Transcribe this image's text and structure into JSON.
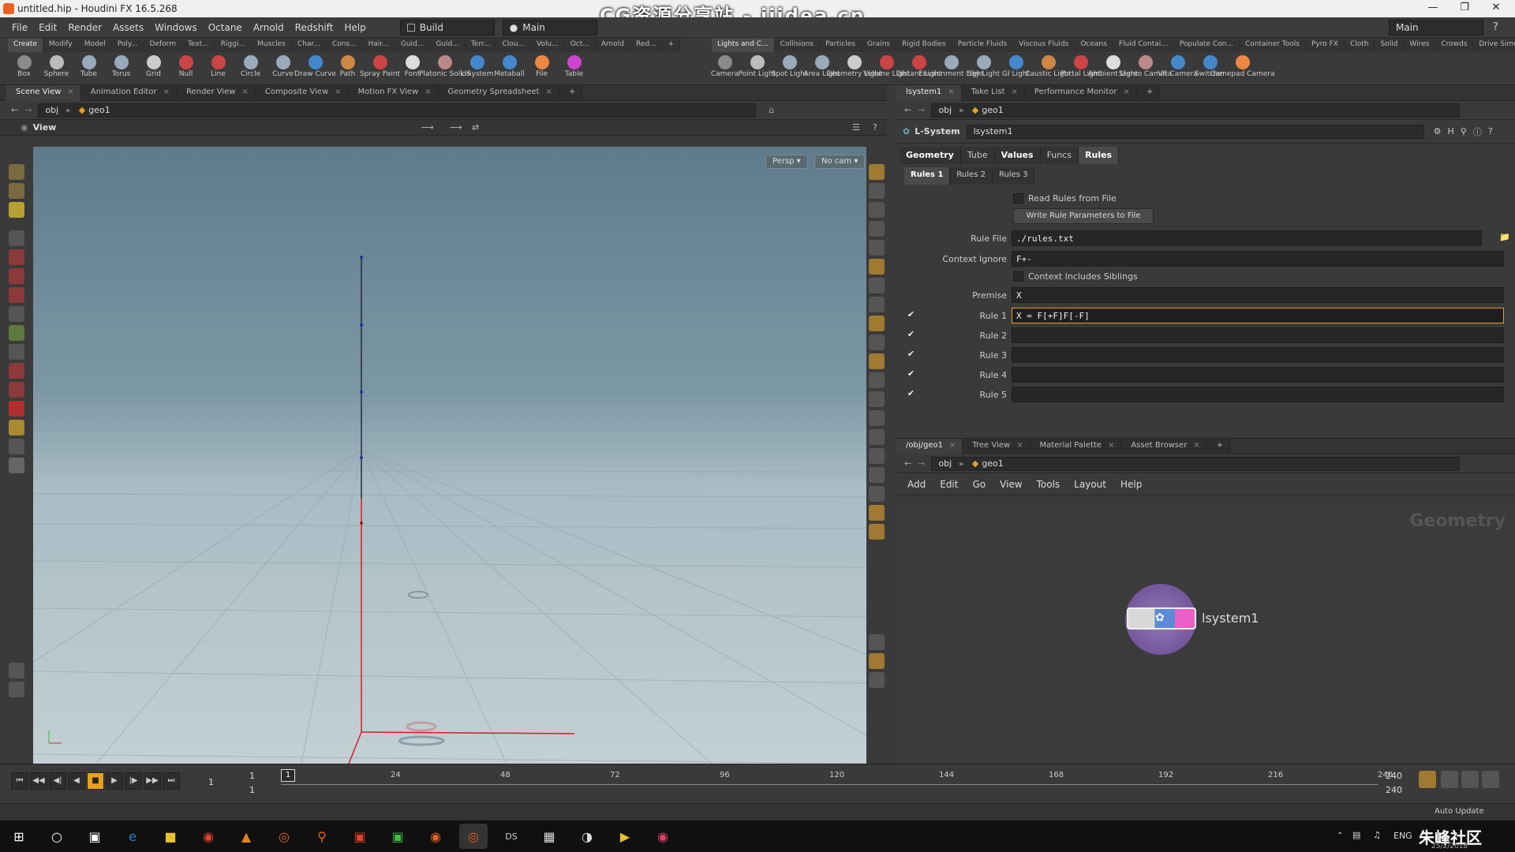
{
  "window": {
    "title": "untitled.hip - Houdini FX 16.5.268",
    "watermark": "CG资源分享站 - iiidea.cn"
  },
  "menu": {
    "items": [
      "File",
      "Edit",
      "Render",
      "Assets",
      "Windows",
      "Octane",
      "Arnold",
      "Redshift",
      "Help"
    ],
    "desktop_build": "Build",
    "desktop_main": "Main",
    "right_main": "Main"
  },
  "shelf": {
    "left_tabs": [
      "Create",
      "Modify",
      "Model",
      "Poly...",
      "Deform",
      "Text...",
      "Riggi...",
      "Muscles",
      "Char...",
      "Cons...",
      "Hair...",
      "Guid...",
      "Guid...",
      "Terr...",
      "Clou...",
      "Volu...",
      "Oct...",
      "Arnold",
      "Red..."
    ],
    "left_tools": [
      "Box",
      "Sphere",
      "Tube",
      "Torus",
      "Grid",
      "Null",
      "Line",
      "Circle",
      "Curve",
      "Draw Curve",
      "Path",
      "Spray Paint",
      "Font",
      "Platonic Solids",
      "L-System",
      "Metaball",
      "File",
      "Table"
    ],
    "right_tabs": [
      "Lights and C...",
      "Collisions",
      "Particles",
      "Grains",
      "Rigid Bodies",
      "Particle Fluids",
      "Viscous Fluids",
      "Oceans",
      "Fluid Contai...",
      "Populate Con...",
      "Container Tools",
      "Pyro FX",
      "Cloth",
      "Solid",
      "Wires",
      "Crowds",
      "Drive Simula..."
    ],
    "right_tools": [
      "Camera",
      "Point Light",
      "Spot Light",
      "Area Light",
      "Geometry Light",
      "Volume Light",
      "Distant Light",
      "Environment Light",
      "Sky Light",
      "GI Light",
      "Caustic Light",
      "Portal Light",
      "Ambient Light",
      "Stereo Camera",
      "VR Camera",
      "Switcher",
      "Gamepad Camera"
    ]
  },
  "left_pane": {
    "tabs": [
      "Scene View",
      "Animation Editor",
      "Render View",
      "Composite View",
      "Motion FX View",
      "Geometry Spreadsheet"
    ],
    "path_obj": "obj",
    "path_geo": "geo1",
    "view_label": "View",
    "persp": "Persp ▾",
    "cam": "No cam ▾"
  },
  "right_top": {
    "tabs": [
      "lsystem1",
      "Take List",
      "Performance Monitor"
    ],
    "path_obj": "obj",
    "path_geo": "geo1",
    "node_type": "L-System",
    "node_name": "lsystem1",
    "param_tabs": [
      "Geometry",
      "Tube",
      "Values",
      "Funcs",
      "Rules"
    ],
    "rule_tabs": [
      "Rules 1",
      "Rules 2",
      "Rules 3"
    ],
    "read_rules": "Read Rules from File",
    "write_rules": "Write Rule Parameters to File",
    "rule_file_label": "Rule File",
    "rule_file_value": "./rules.txt",
    "context_ignore_label": "Context Ignore",
    "context_ignore_value": "F+-",
    "context_siblings": "Context Includes Siblings",
    "premise_label": "Premise",
    "premise_value": "X",
    "rules": [
      {
        "label": "Rule 1",
        "value": "X = F[+F]F[-F]",
        "checked": true
      },
      {
        "label": "Rule 2",
        "value": "",
        "checked": true
      },
      {
        "label": "Rule 3",
        "value": "",
        "checked": true
      },
      {
        "label": "Rule 4",
        "value": "",
        "checked": true
      },
      {
        "label": "Rule 5",
        "value": "",
        "checked": true
      }
    ]
  },
  "right_bottom": {
    "tabs": [
      "/obj/geo1",
      "Tree View",
      "Material Palette",
      "Asset Browser"
    ],
    "path_obj": "obj",
    "path_geo": "geo1",
    "menu": [
      "Add",
      "Edit",
      "Go",
      "View",
      "Tools",
      "Layout",
      "Help"
    ],
    "context_label": "Geometry",
    "node_label": "lsystem1"
  },
  "timeline": {
    "ticks": [
      "1",
      "24",
      "48",
      "72",
      "96",
      "120",
      "144",
      "168",
      "192",
      "216",
      "240"
    ],
    "current_frame": "1",
    "start_frame": "1",
    "start_frame_2": "1",
    "end_frame": "240",
    "end_frame_2": "240",
    "auto_update": "Auto Update"
  },
  "taskbar": {
    "lang": "ENG",
    "brand": "朱峰社区",
    "date": "25/2/2018"
  },
  "colors": {
    "accent": "#e8a020",
    "viewport_sky": "#6d8898",
    "viewport_ground": "#c3d0d4",
    "axis_red": "#d32020",
    "node_ring": "#7a4fa0"
  }
}
